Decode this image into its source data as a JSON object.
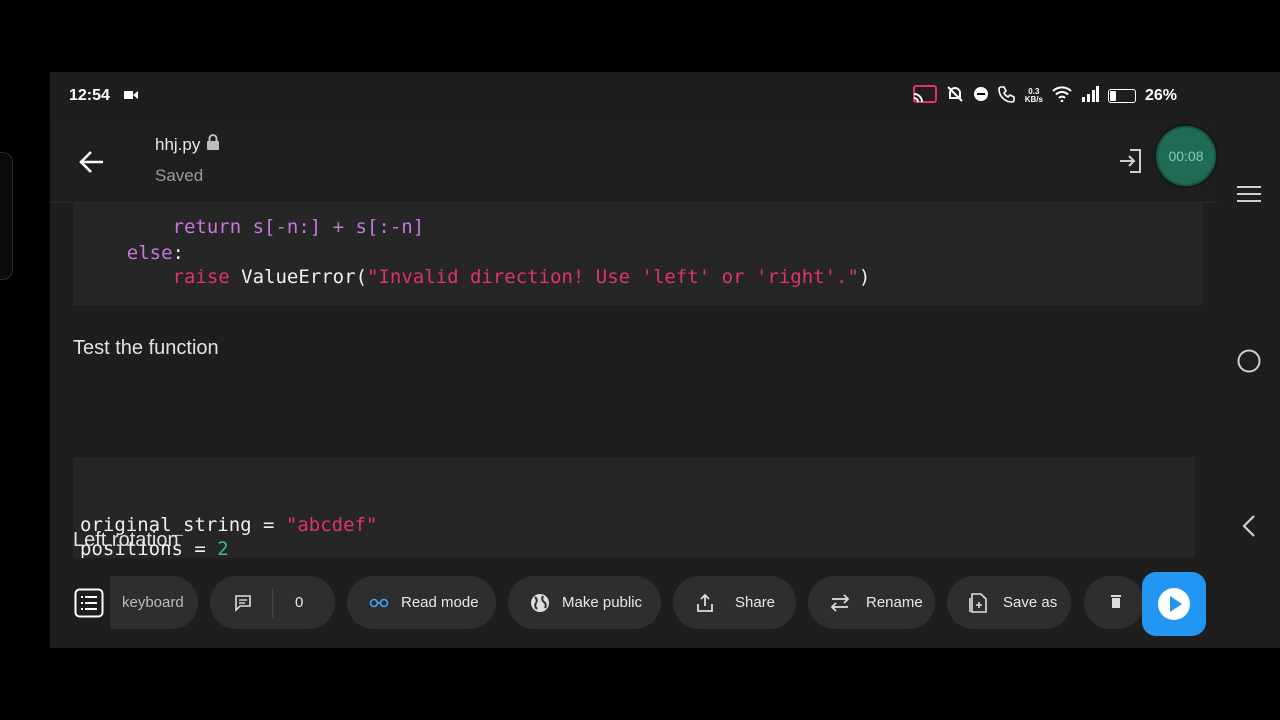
{
  "status": {
    "time": "12:54",
    "speed_value": "0.3",
    "speed_unit": "KB/s",
    "battery": "26%"
  },
  "header": {
    "file_name": "hhj.py",
    "state": "Saved",
    "timer": "00:08"
  },
  "code_block_1": {
    "line_partial": "        return s[-n:] + s[:-n]",
    "else_kw": "else",
    "raise_kw": "raise",
    "raise_fn": "ValueError",
    "raise_msg": "\"Invalid direction! Use 'left' or 'right'.\""
  },
  "heading_test": "Test the function",
  "code_block_2": {
    "var1": "original_string",
    "val1": "\"abcdef\"",
    "var2": "positions",
    "val2": "2"
  },
  "heading_left": "Left rotation",
  "toolbar": {
    "keyboard": "keyboard",
    "comments_count": "0",
    "read_mode": "Read mode",
    "make_public": "Make public",
    "share": "Share",
    "rename": "Rename",
    "save_as": "Save as"
  },
  "colors": {
    "accent_run": "#2196f3",
    "timer_bg": "#1f6b55",
    "keyword": "#c678dd",
    "string": "#e0336a",
    "number": "#3fbf8a"
  }
}
